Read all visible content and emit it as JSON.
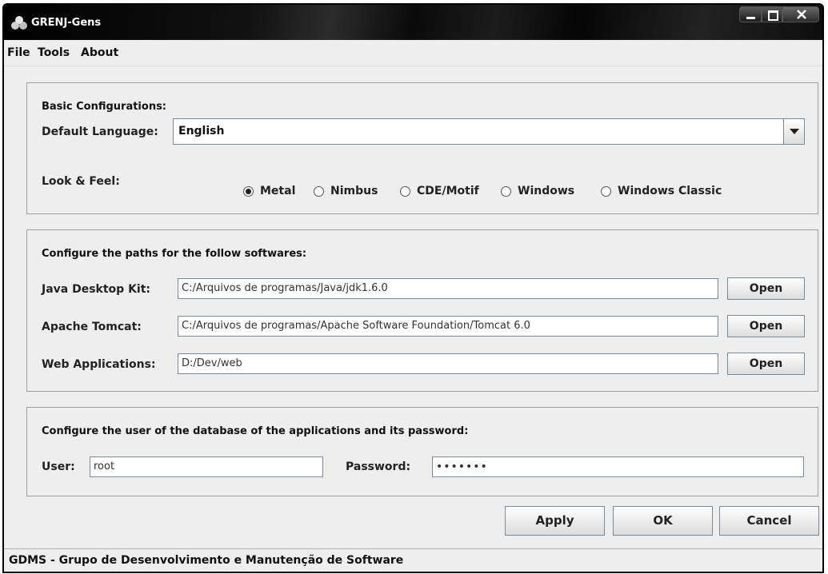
{
  "window": {
    "title": "GRENJ-Gens"
  },
  "menu": {
    "items": [
      "File",
      "Tools",
      "About"
    ]
  },
  "basic": {
    "title": "Basic Configurations:",
    "language_label": "Default Language:",
    "language_value": "English",
    "laf_label": "Look & Feel:",
    "laf_options": [
      "Metal",
      "Nimbus",
      "CDE/Motif",
      "Windows",
      "Windows Classic"
    ],
    "laf_selected": "Metal"
  },
  "paths": {
    "title": "Configure the paths for the follow softwares:",
    "rows": [
      {
        "label": "Java Desktop Kit:",
        "value": "C:/Arquivos de programas/Java/jdk1.6.0",
        "button": "Open"
      },
      {
        "label": "Apache Tomcat:",
        "value": "C:/Arquivos de programas/Apache Software Foundation/Tomcat 6.0",
        "button": "Open"
      },
      {
        "label": "Web Applications:",
        "value": "D:/Dev/web",
        "button": "Open"
      }
    ]
  },
  "db": {
    "title": "Configure the user of the database of the applications and its password:",
    "user_label": "User:",
    "user_value": "root",
    "password_label": "Password:",
    "password_value": "•••••••"
  },
  "actions": {
    "apply": "Apply",
    "ok": "OK",
    "cancel": "Cancel"
  },
  "status": {
    "text": "GDMS - Grupo de Desenvolvimento e Manutenção de Software"
  },
  "colors": {
    "titlebar": "#111111",
    "window_bg": "#eeeeee",
    "field_border": "#7a8a99"
  }
}
